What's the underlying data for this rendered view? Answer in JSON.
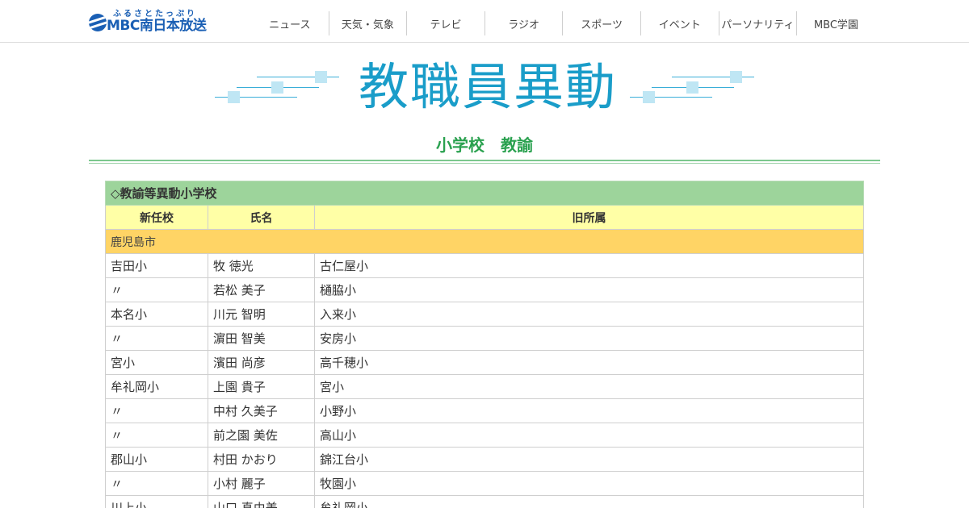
{
  "header": {
    "logo_kana": "ふるさとたっぷり",
    "logo_text": "MBC南日本放送",
    "nav": [
      "ニュース",
      "天気・気象",
      "テレビ",
      "ラジオ",
      "スポーツ",
      "イベント",
      "パーソナリティ",
      "MBC学園"
    ]
  },
  "page": {
    "title": "教職員異動",
    "subtitle_a": "小学校",
    "subtitle_b": "教諭"
  },
  "table": {
    "caption": "◇教諭等異動小学校",
    "columns": [
      "新任校",
      "氏名",
      "旧所属"
    ],
    "region": "鹿児島市",
    "rows": [
      [
        "吉田小",
        "牧 徳光",
        "古仁屋小"
      ],
      [
        "〃",
        "若松 美子",
        "樋脇小"
      ],
      [
        "本名小",
        "川元 智明",
        "入来小"
      ],
      [
        "〃",
        "濵田 智美",
        "安房小"
      ],
      [
        "宮小",
        "濱田 尚彦",
        "高千穂小"
      ],
      [
        "牟礼岡小",
        "上園 貴子",
        "宮小"
      ],
      [
        "〃",
        "中村 久美子",
        "小野小"
      ],
      [
        "〃",
        "前之園 美佐",
        "高山小"
      ],
      [
        "郡山小",
        "村田 かおり",
        "錦江台小"
      ],
      [
        "〃",
        "小村 麗子",
        "牧園小"
      ],
      [
        "川上小",
        "山口 真由美",
        "牟礼岡小"
      ]
    ]
  },
  "colors": {
    "brand_blue": "#1a5fb4",
    "title_blue": "#1a9dc9",
    "subtitle_green": "#2aa14f",
    "caption_green": "#9dd49b",
    "header_yellow": "#ffffa6",
    "region_orange": "#ffd465"
  }
}
